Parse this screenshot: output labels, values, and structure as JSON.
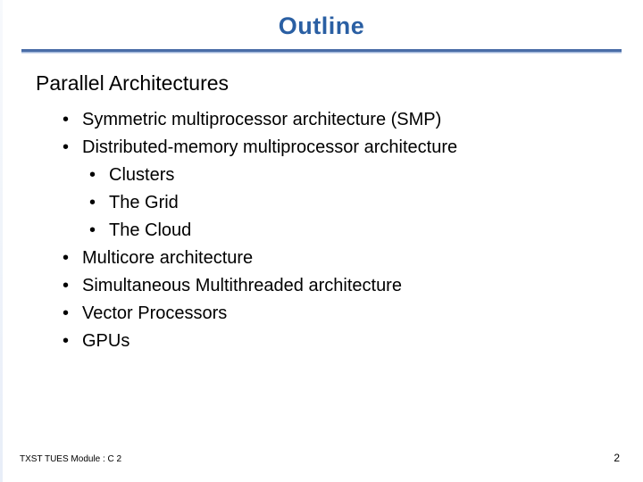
{
  "title": "Outline",
  "title_color": "#2a5fa3",
  "section_heading": "Parallel Architectures",
  "bullets": [
    {
      "level": 1,
      "text": "Symmetric multiprocessor architecture (SMP)"
    },
    {
      "level": 1,
      "text": "Distributed-memory multiprocessor architecture"
    },
    {
      "level": 2,
      "text": "Clusters"
    },
    {
      "level": 2,
      "text": "The Grid"
    },
    {
      "level": 2,
      "text": "The Cloud"
    },
    {
      "level": 1,
      "text": "Multicore architecture"
    },
    {
      "level": 1,
      "text": "Simultaneous Multithreaded architecture"
    },
    {
      "level": 1,
      "text": "Vector Processors"
    },
    {
      "level": 1,
      "text": "GPUs"
    }
  ],
  "footer_left": "TXST TUES Module : C 2",
  "footer_right": "2"
}
